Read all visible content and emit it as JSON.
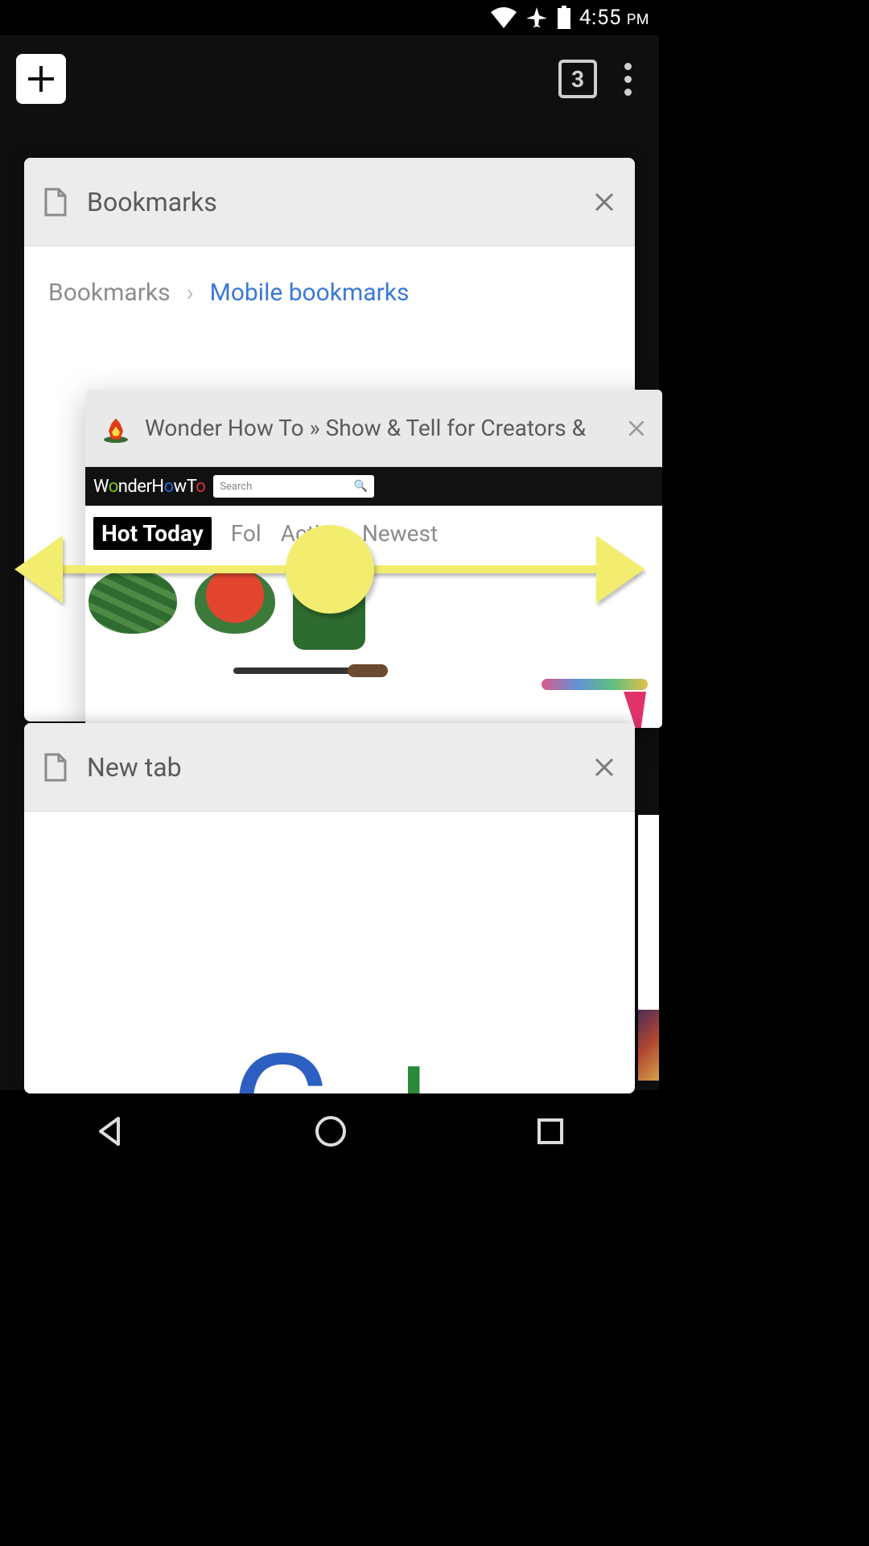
{
  "status_bar": {
    "time": "4:55",
    "period": "PM"
  },
  "toolbar": {
    "tab_count": "3"
  },
  "tabs": {
    "bookmarks": {
      "title": "Bookmarks",
      "breadcrumb_root": "Bookmarks",
      "breadcrumb_current": "Mobile bookmarks"
    },
    "wonder": {
      "title": "Wonder How To » Show & Tell for Creators &",
      "logo": "WonderHowTo",
      "search_placeholder": "Search",
      "nav": {
        "hot": "Hot Today",
        "fol": "Fol",
        "active": "Active",
        "newest": "Newest"
      }
    },
    "newtab": {
      "title": "New tab"
    }
  }
}
